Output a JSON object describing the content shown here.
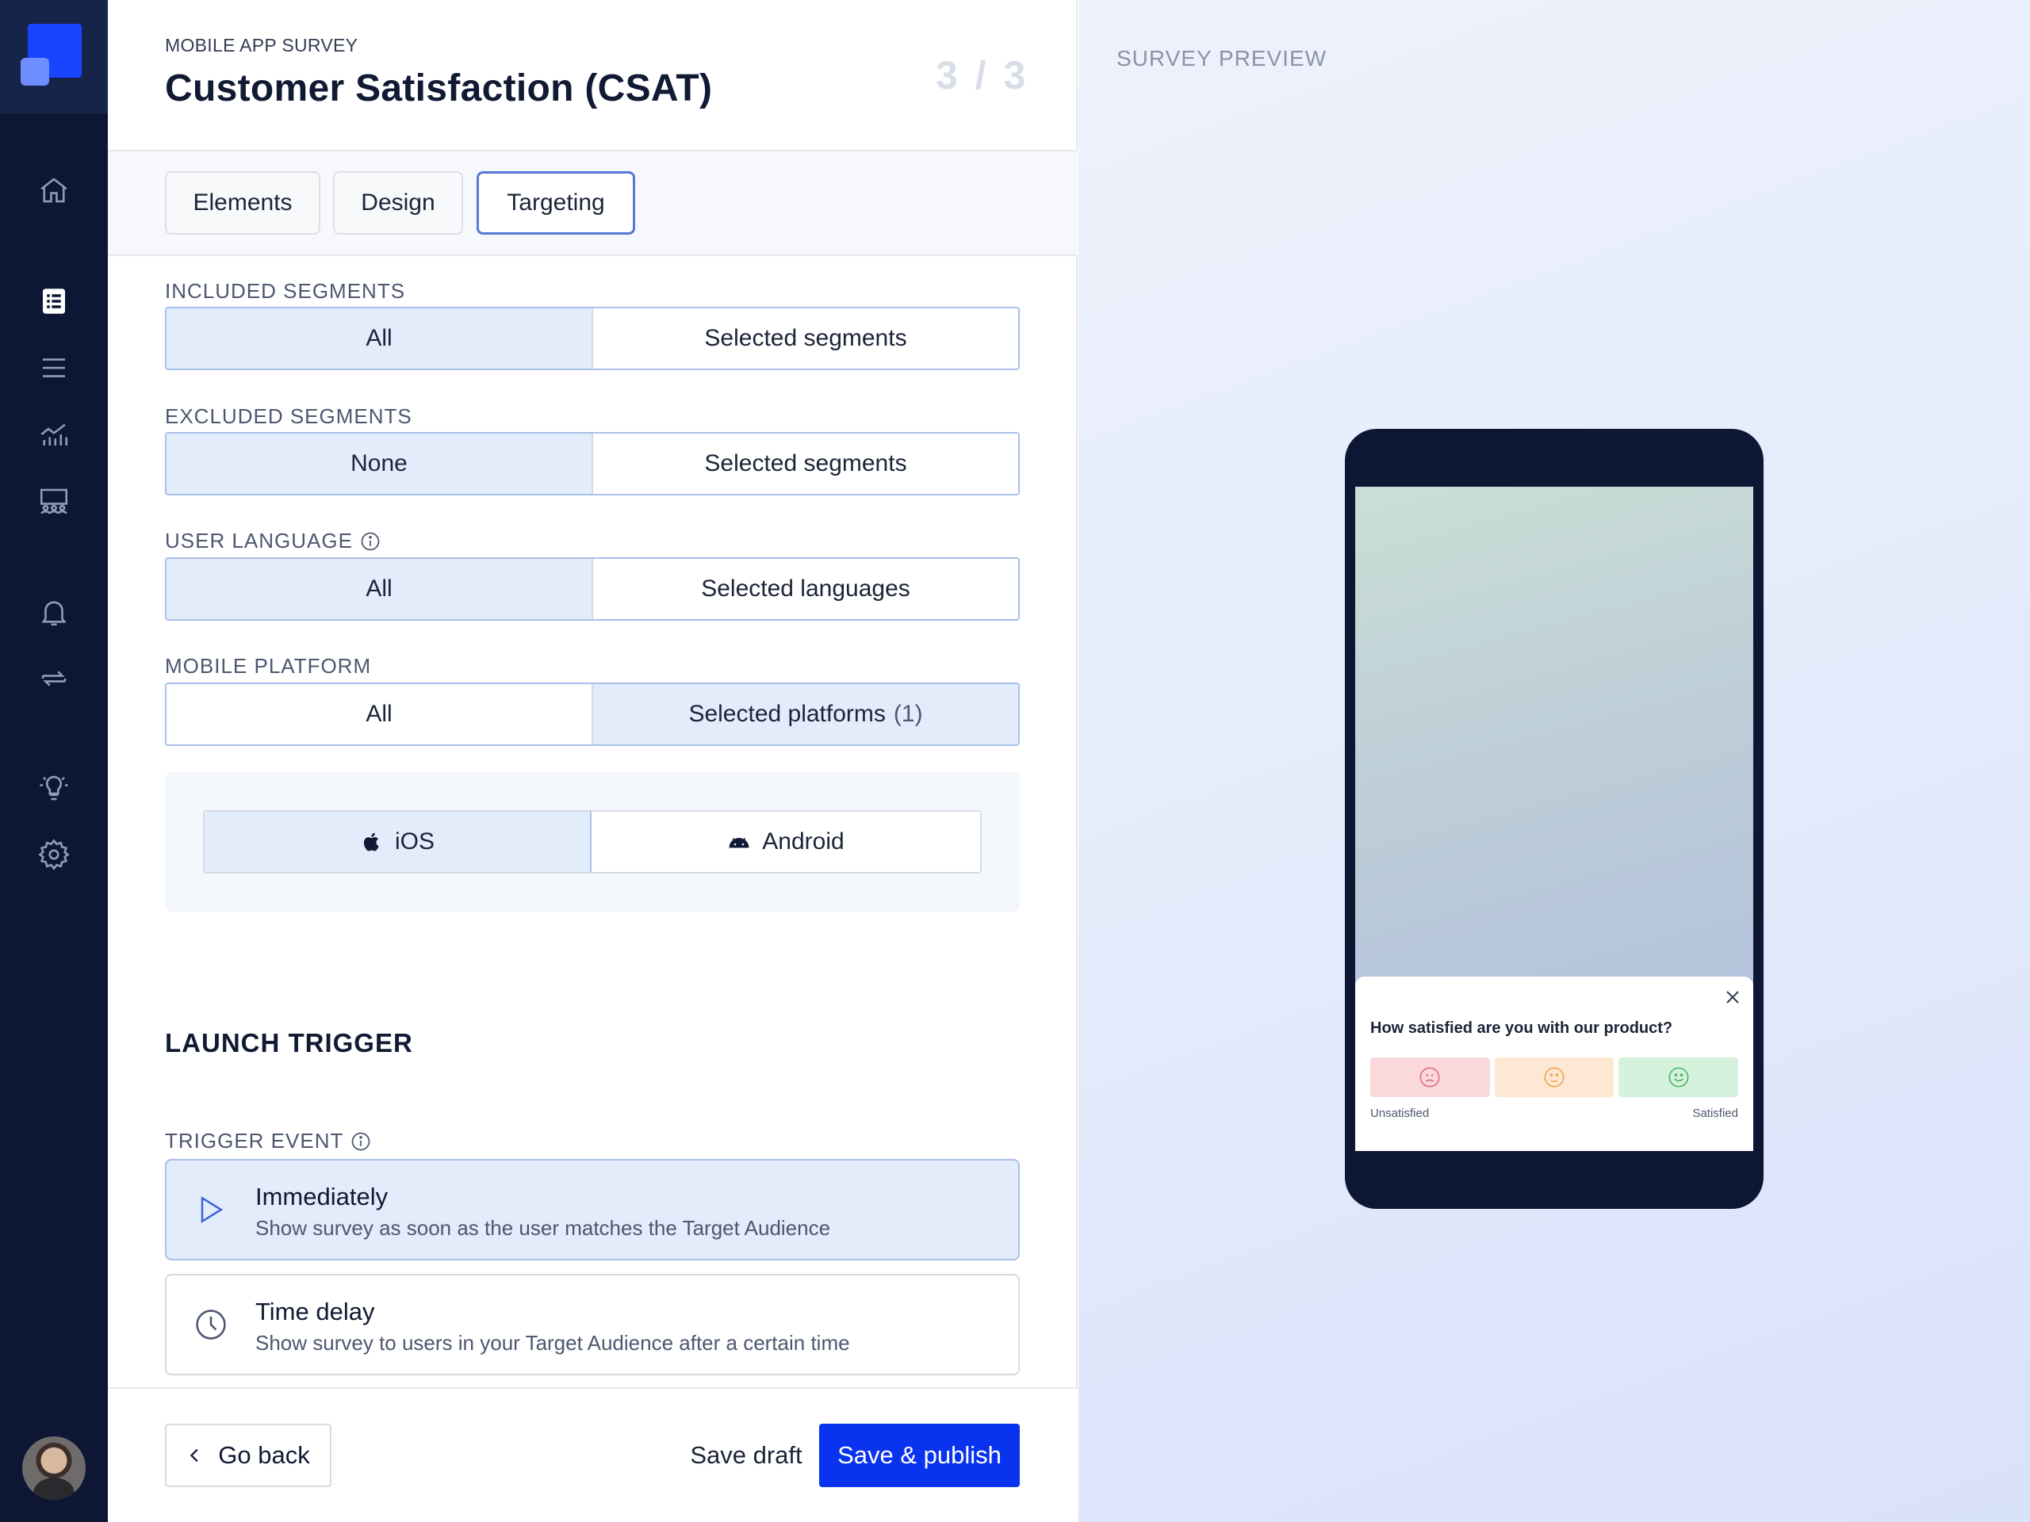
{
  "sidebar": {
    "icons": [
      "home-icon",
      "surveys-icon",
      "list-icon",
      "analytics-icon",
      "audience-icon",
      "bell-icon",
      "sync-icon",
      "lightbulb-icon",
      "gear-icon"
    ]
  },
  "header": {
    "kicker": "MOBILE APP SURVEY",
    "title": "Customer Satisfaction (CSAT)",
    "step": "3 / 3"
  },
  "tabs": [
    "Elements",
    "Design",
    "Targeting"
  ],
  "targeting": {
    "included": {
      "label": "INCLUDED SEGMENTS",
      "options": [
        "All",
        "Selected segments"
      ],
      "selected": "All"
    },
    "excluded": {
      "label": "EXCLUDED SEGMENTS",
      "options": [
        "None",
        "Selected segments"
      ],
      "selected": "None"
    },
    "language": {
      "label": "USER LANGUAGE",
      "options": [
        "All",
        "Selected languages"
      ],
      "selected": "All"
    },
    "platform": {
      "label": "MOBILE PLATFORM",
      "options": [
        "All",
        "Selected platforms"
      ],
      "count": "(1)",
      "selected": "Selected platforms"
    },
    "platforms": {
      "ios": "iOS",
      "android": "Android",
      "selected": "iOS"
    }
  },
  "launch": {
    "title": "LAUNCH TRIGGER",
    "trigger_label": "TRIGGER EVENT",
    "options": [
      {
        "name": "Immediately",
        "desc": "Show survey as soon as the user matches the Target Audience",
        "selected": true
      },
      {
        "name": "Time delay",
        "desc": "Show survey to users in your Target Audience after a certain time",
        "selected": false
      }
    ]
  },
  "footer": {
    "back": "Go back",
    "draft": "Save draft",
    "publish": "Save & publish"
  },
  "preview": {
    "label": "SURVEY PREVIEW",
    "question": "How satisfied are you with our product?",
    "low_label": "Unsatisfied",
    "high_label": "Satisfied"
  },
  "colors": {
    "accent": "#0a33f0",
    "selected_bg": "#e3ecfa",
    "rail_bg": "#0d1633"
  }
}
